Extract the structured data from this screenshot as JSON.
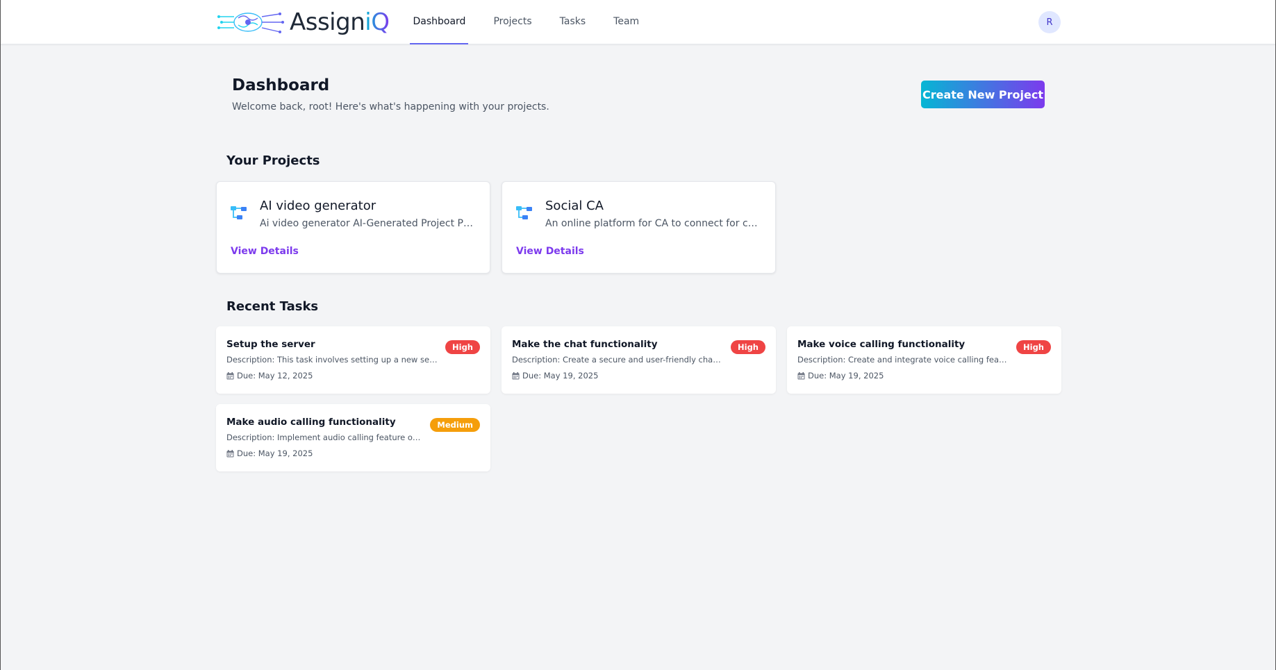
{
  "app": {
    "logo_text": "Assign",
    "logo_accent": "iQ"
  },
  "nav": {
    "items": [
      {
        "label": "Dashboard",
        "active": true
      },
      {
        "label": "Projects",
        "active": false
      },
      {
        "label": "Tasks",
        "active": false
      },
      {
        "label": "Team",
        "active": false
      }
    ]
  },
  "user": {
    "avatar_initial": "R"
  },
  "header": {
    "title": "Dashboard",
    "subtitle": "Welcome back, root! Here's what's happening with your projects.",
    "create_label": "Create New Project"
  },
  "projects": {
    "section_title": "Your Projects",
    "items": [
      {
        "name": "AI video generator",
        "description": "Ai video generator AI-Generated Project Plan: Overview, Goals and Features",
        "link": "View Details",
        "icon": "project-tree-icon"
      },
      {
        "name": "Social CA",
        "description": "An online platform for CA to connect for consultation with clients",
        "link": "View Details",
        "icon": "project-tree-icon"
      }
    ]
  },
  "tasks": {
    "section_title": "Recent Tasks",
    "items": [
      {
        "title": "Setup the server",
        "description": "Description: This task involves setting up a new server environment",
        "due": "Due: May 12, 2025",
        "priority": "High"
      },
      {
        "title": "Make the chat functionality",
        "description": "Description: Create a secure and user-friendly chat functionality",
        "due": "Due: May 19, 2025",
        "priority": "High"
      },
      {
        "title": "Make voice calling functionality",
        "description": "Description: Create and integrate voice calling feature into the app",
        "due": "Due: May 19, 2025",
        "priority": "High"
      },
      {
        "title": "Make audio calling functionality",
        "description": "Description: Implement audio calling feature on the platform",
        "due": "Due: May 19, 2025",
        "priority": "Medium"
      }
    ]
  },
  "colors": {
    "accent_start": "#06b6d4",
    "accent_end": "#7c3aed",
    "high": "#ef4444",
    "medium": "#f59e0b"
  }
}
